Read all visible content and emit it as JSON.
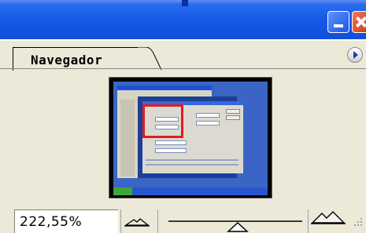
{
  "window": {
    "minimize_icon": "minimize-icon",
    "close_icon": "close-icon"
  },
  "panel": {
    "tab_label": "Navegador",
    "menu_icon": "panel-menu-arrow-icon"
  },
  "navigator": {
    "zoom_value": "222,55%",
    "zoom_out_icon": "zoom-out-mountain-icon",
    "zoom_in_icon": "zoom-in-mountain-icon",
    "slider_icon": "zoom-slider-thumb-icon"
  },
  "colors": {
    "titlebar": "#1659e8",
    "panel_bg": "#ece9d8",
    "proxy_box": "#e61b1b",
    "close_button": "#cf3516"
  }
}
